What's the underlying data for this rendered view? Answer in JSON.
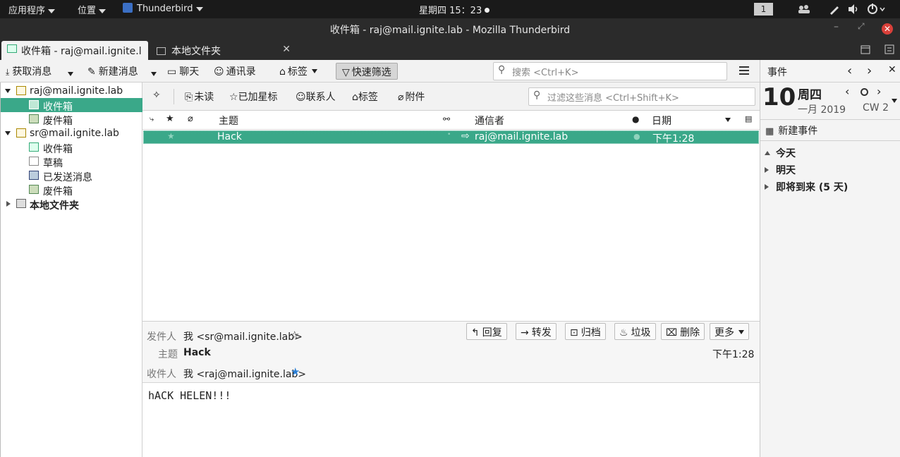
{
  "topbar": {
    "apps": "应用程序",
    "places": "位置",
    "app_name": "Thunderbird",
    "clock": "星期四 15：23",
    "workspace": "1"
  },
  "window": {
    "title": "收件箱 - raj@mail.ignite.lab - Mozilla Thunderbird"
  },
  "tabs": [
    {
      "label": "收件箱 - raj@mail.ignite.la"
    },
    {
      "label": "本地文件夹"
    }
  ],
  "toolbar": {
    "get_mail": "获取消息",
    "write": "新建消息",
    "chat": "聊天",
    "address_book": "通讯录",
    "tag": "标签",
    "quick_filter": "快速筛选",
    "search_placeholder": "搜索 <Ctrl+K>"
  },
  "folders": {
    "account1": "raj@mail.ignite.lab",
    "account1_items": [
      "收件箱",
      "废件箱"
    ],
    "account2": "sr@mail.ignite.lab",
    "account2_items": [
      "收件箱",
      "草稿",
      "已发送消息",
      "废件箱"
    ],
    "local": "本地文件夹"
  },
  "quickfilter": {
    "unread": "未读",
    "starred": "已加星标",
    "contact": "联系人",
    "tags": "标签",
    "attachment": "附件",
    "filter_placeholder": "过滤这些消息 <Ctrl+Shift+K>"
  },
  "thread": {
    "col_subject": "主题",
    "col_correspondent": "通信者",
    "col_date": "日期",
    "rows": [
      {
        "subject": "Hack",
        "correspondent": "raj@mail.ignite.lab",
        "date": "下午1:28"
      }
    ]
  },
  "message": {
    "from_label": "发件人",
    "from": "我 <sr@mail.ignite.lab>",
    "subject_label": "主题",
    "subject": "Hack",
    "to_label": "收件人",
    "to": "我 <raj@mail.ignite.lab>",
    "date": "下午1:28",
    "buttons": {
      "reply": "回复",
      "forward": "转发",
      "archive": "归档",
      "junk": "垃圾",
      "delete": "删除",
      "more": "更多"
    },
    "body": "hACK HELEN!!!"
  },
  "today_pane": {
    "title": "事件",
    "day": "10",
    "weekday": "周四",
    "month_year": "一月 2019",
    "cw": "CW 2",
    "new_event": "新建事件",
    "sections": [
      "今天",
      "明天",
      "即将到来 (5 天)"
    ]
  },
  "colors": {
    "selection": "#3aa889",
    "topbar": "#1a1a1a",
    "titlebar": "#2b2b2b"
  }
}
